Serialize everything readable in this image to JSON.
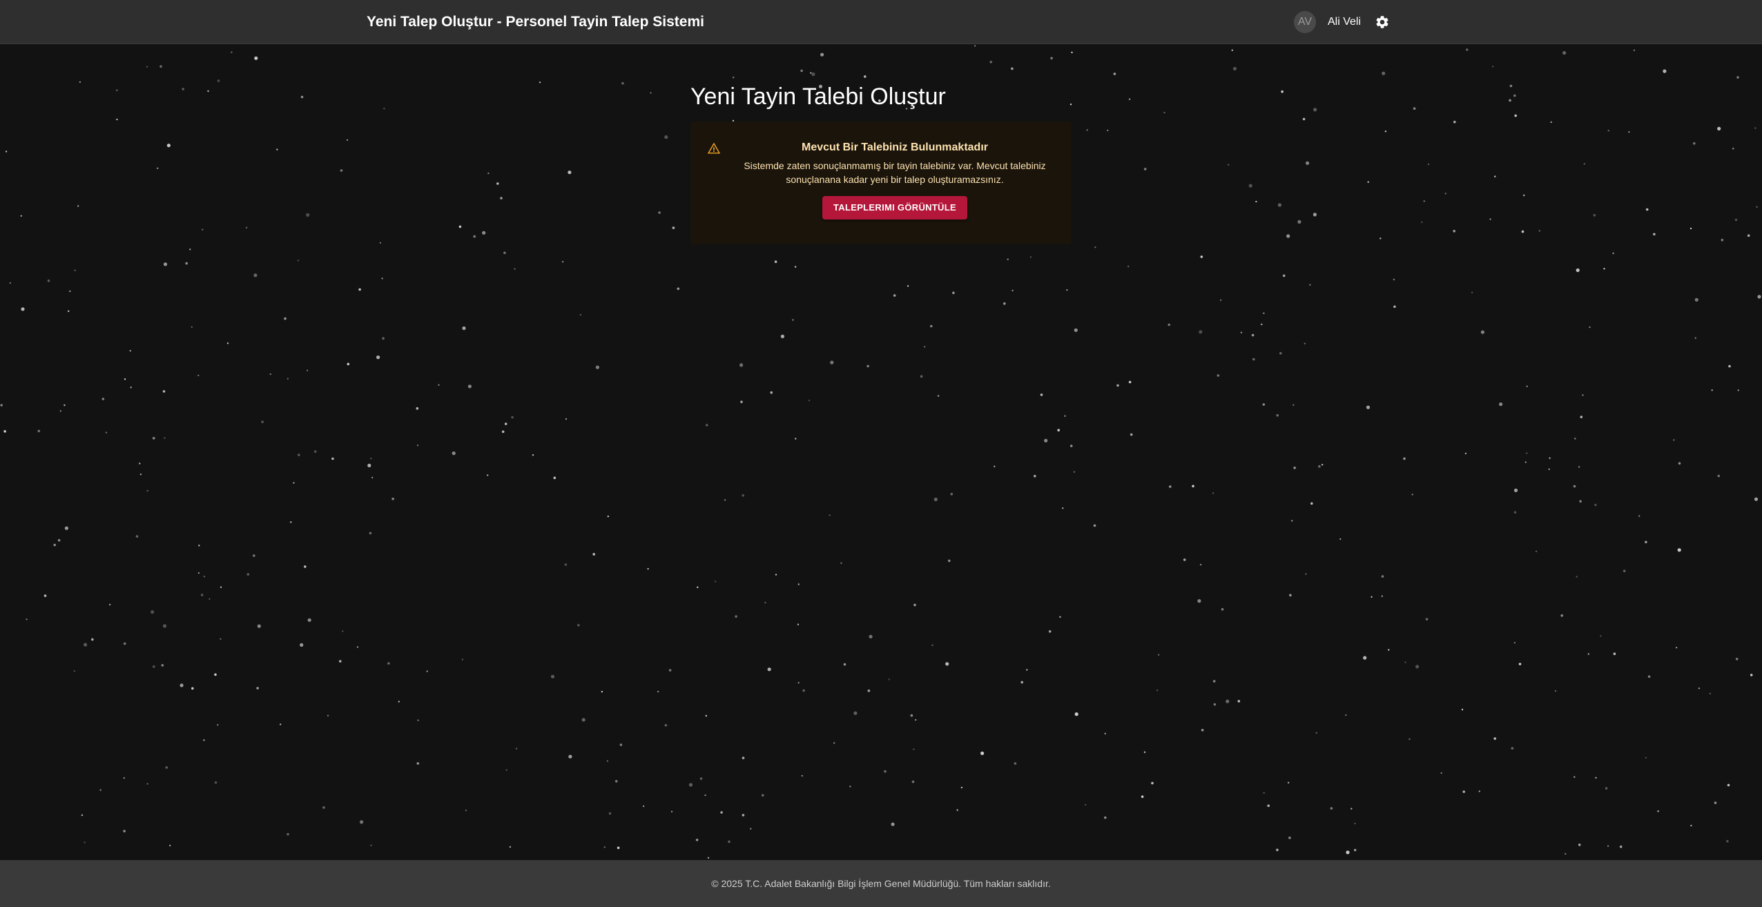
{
  "appbar": {
    "title": "Yeni Talep Oluştur - Personel Tayin Talep Sistemi",
    "user": {
      "initials": "AV",
      "name": "Ali Veli"
    },
    "settings_icon": "gear-icon"
  },
  "main": {
    "title": "Yeni Tayin Talebi Oluştur",
    "alert": {
      "icon": "warning-icon",
      "title": "Mevcut Bir Talebiniz Bulunmaktadır",
      "message": "Sistemde zaten sonuçlanmamış bir tayin talebiniz var. Mevcut talebiniz sonuçlanana kadar yeni bir talep oluşturamazsınız.",
      "button_label": "TALEPLERIMI GÖRÜNTÜLE"
    }
  },
  "footer": {
    "text": "© 2025 T.C. Adalet Bakanlığı Bilgi İşlem Genel Müdürlüğü. Tüm hakları saklıdır."
  },
  "colors": {
    "background": "#121212",
    "appbar": "#2f2f2f",
    "footer": "#3a3a3a",
    "alert_background": "#1a140b",
    "alert_text": "#ffe3b0",
    "warning": "#f5a623",
    "button": "#b5173a"
  }
}
